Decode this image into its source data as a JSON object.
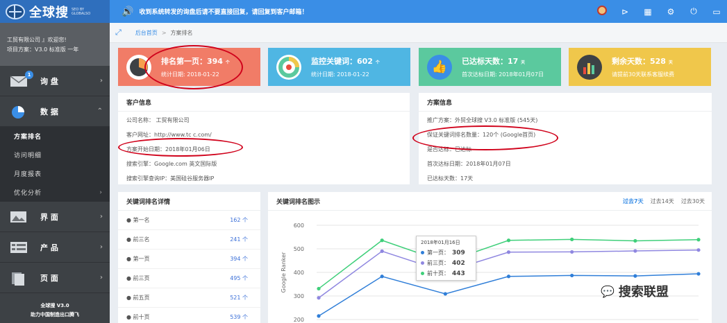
{
  "header": {
    "brand": "全球搜",
    "brand_sub": "SEO BY GLOBALSO",
    "notice": "收到系统转发的询盘后请不要直接回复，请回复到客户邮箱！"
  },
  "sidebar": {
    "user_line1": "工贸有限公司 』欢迎您!",
    "user_line2": "项目方案：V3.0 标准版 一年",
    "items": [
      {
        "label": "询 盘",
        "badge": "1"
      },
      {
        "label": "数 据"
      },
      {
        "label": "界 面"
      },
      {
        "label": "产 品"
      },
      {
        "label": "页 面"
      }
    ],
    "sub_items": [
      "方案排名",
      "访问明细",
      "月度报表",
      "优化分析"
    ],
    "footer1": "全球搜 V3.0",
    "footer2": "助力中国制造出口腾飞"
  },
  "breadcrumb": {
    "home": "后台首页",
    "sep": ">",
    "current": "方案排名"
  },
  "stats": [
    {
      "title": "排名第一页：394",
      "unit": "个",
      "sub": "统计日期: 2018-01-22",
      "color": "#f17c67"
    },
    {
      "title": "监控关键词：602",
      "unit": "个",
      "sub": "统计日期: 2018-01-22",
      "color": "#4fb6e3"
    },
    {
      "title": "已达标天数：17",
      "unit": "天",
      "sub": "首次达标日期: 2018年01月07日",
      "color": "#5bc99e"
    },
    {
      "title": "剩余天数：528",
      "unit": "天",
      "sub": "请提前30天联系客服续费",
      "color": "#f0c74b"
    }
  ],
  "customer": {
    "title": "客户信息",
    "company": "公司名称：            工贸有限公司",
    "site": "客户网址：http://www.tc       c.com/",
    "start": "方案开始日期：2018年01月06日",
    "engine": "搜索引擎：Google.com 英文国际版",
    "ip": "搜索引擎查询IP：美国硅谷服务器IP"
  },
  "plan": {
    "title": "方案信息",
    "name": "推广方案：外贸全球搜 V3.0 标准版 (545天)",
    "guarantee": "保证关键词排名数量：120个 (Google首页)",
    "reached": "是否达标：已达标",
    "first_date": "首次达标日期：2018年01月07日",
    "days": "已达标天数：17天"
  },
  "rank_detail": {
    "title": "关键词排名详情",
    "rows": [
      {
        "label": "第一名",
        "value": "162 个"
      },
      {
        "label": "前三名",
        "value": "241 个"
      },
      {
        "label": "第一页",
        "value": "394 个"
      },
      {
        "label": "前三页",
        "value": "495 个"
      },
      {
        "label": "前五页",
        "value": "521 个"
      },
      {
        "label": "前十页",
        "value": "539 个"
      }
    ]
  },
  "chart_panel": {
    "title": "关键词排名图示",
    "tabs": [
      "过去7天",
      "过去14天",
      "过去30天"
    ]
  },
  "tooltip": {
    "date": "2018年01月16日",
    "rows": [
      {
        "label": "第一页：",
        "value": "309",
        "color": "#2f7ed8"
      },
      {
        "label": "前三页：",
        "value": "402",
        "color": "#8f87e0"
      },
      {
        "label": "前十页：",
        "value": "443",
        "color": "#3fcf7a"
      }
    ]
  },
  "watermark": "搜索联盟",
  "chart_data": {
    "type": "line",
    "ylabel": "Google Ranker",
    "ylim": [
      200,
      600
    ],
    "yticks": [
      200,
      300,
      400,
      500,
      600
    ],
    "x": [
      1,
      2,
      3,
      4,
      5,
      6,
      7
    ],
    "series": [
      {
        "name": "第一页",
        "color": "#2f7ed8",
        "values": [
          215,
          383,
          309,
          383,
          387,
          385,
          394
        ]
      },
      {
        "name": "前三页",
        "color": "#8f87e0",
        "values": [
          292,
          490,
          402,
          486,
          487,
          491,
          495
        ]
      },
      {
        "name": "前十页",
        "color": "#3fcf7a",
        "values": [
          331,
          536,
          443,
          536,
          540,
          534,
          539
        ]
      }
    ]
  }
}
